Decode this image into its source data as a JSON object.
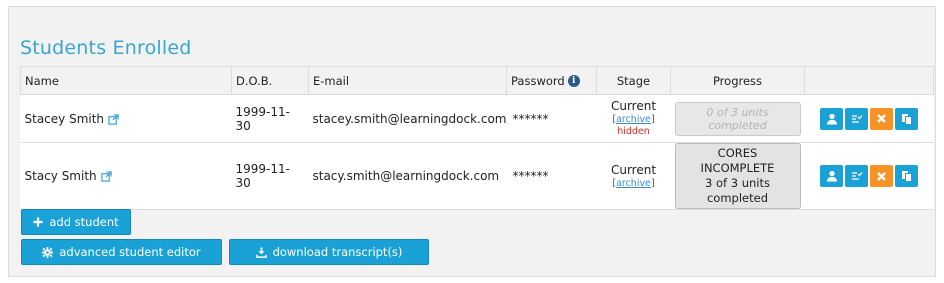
{
  "title": "Students Enrolled",
  "columns": {
    "name": "Name",
    "dob": "D.O.B.",
    "email": "E-mail",
    "password": "Password",
    "stage": "Stage",
    "progress": "Progress"
  },
  "rows": [
    {
      "name": "Stacey Smith",
      "dob": "1999-11-30",
      "email": "stacey.smith@learningdock.com",
      "password": "******",
      "stage": "Current",
      "archive_open": "[",
      "archive": "archive",
      "archive_close": "]",
      "stage_note": "hidden",
      "progress_line1": "",
      "progress_line2": "0 of 3 units completed"
    },
    {
      "name": "Stacy Smith",
      "dob": "1999-11-30",
      "email": "stacy.smith@learningdock.com",
      "password": "******",
      "stage": "Current",
      "archive_open": "[",
      "archive": "archive",
      "archive_close": "]",
      "stage_note": "",
      "progress_line1": "CORES INCOMPLETE",
      "progress_line2": "3 of 3 units completed"
    }
  ],
  "buttons": {
    "add_student": "add student",
    "advanced_editor": "advanced student editor",
    "download_transcripts": "download transcript(s)"
  },
  "colors": {
    "accent": "#1aa2d6",
    "title": "#3aa6cf",
    "delete": "#f79226",
    "hidden_note": "#c9302c"
  },
  "icons": {
    "external_link": "external-link-icon",
    "info": "info-icon",
    "user": "user-icon",
    "checklist": "checklist-icon",
    "delete": "close-icon",
    "copy": "copy-icon",
    "plus": "plus-icon",
    "gear": "gear-icon",
    "download": "download-icon"
  }
}
